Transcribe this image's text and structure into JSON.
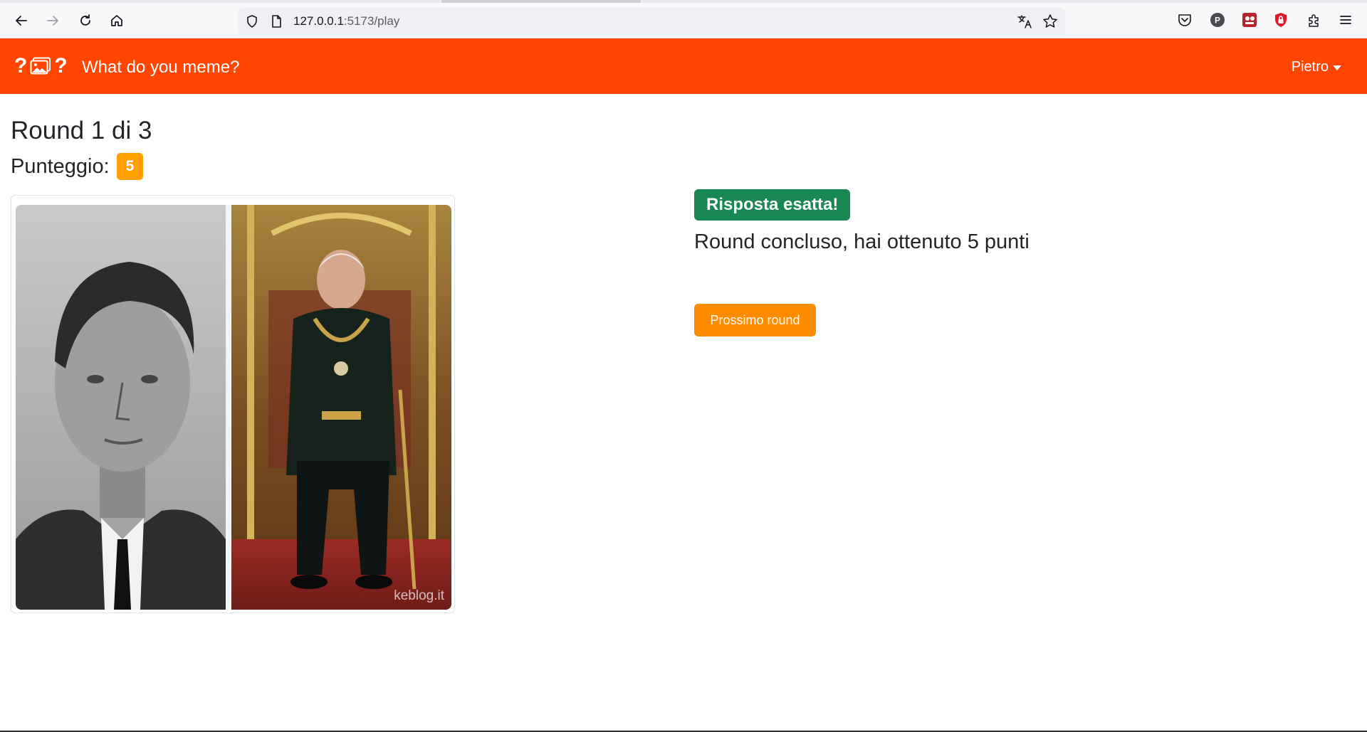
{
  "browser": {
    "url_host": "127.0.0.1",
    "url_rest": ":5173/play",
    "icons": [
      "back-arrow-icon",
      "forward-arrow-icon",
      "reload-icon",
      "home-icon",
      "shield-icon",
      "page-icon",
      "translate-icon",
      "star-icon",
      "pocket-icon",
      "profile-p-icon",
      "extension-red-icon",
      "lock-shield-icon",
      "puzzle-icon",
      "menu-icon"
    ]
  },
  "navbar": {
    "brand_glyph_left": "?",
    "brand_glyph_right": "?",
    "title": "What do you meme?",
    "user": "Pietro",
    "color": "#ff4500"
  },
  "game": {
    "round_title": "Round 1 di 3",
    "score_label": "Punteggio:",
    "score_value": "5",
    "result_badge": "Risposta esatta!",
    "result_message": "Round concluso, hai ottenuto 5 punti",
    "next_button": "Prossimo round",
    "meme_watermark": "keblog.it"
  },
  "colors": {
    "success": "#198754",
    "score_badge": "#ffa000",
    "next_button": "#ff8c00"
  }
}
